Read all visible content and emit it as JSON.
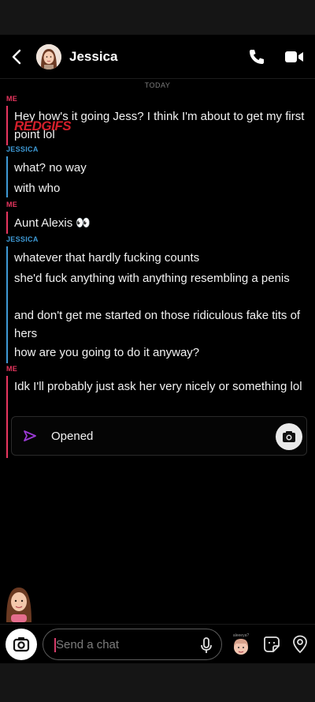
{
  "header": {
    "contact_name": "Jessica"
  },
  "chat": {
    "date_divider": "TODAY",
    "watermark": "REDGIFS",
    "sender_me": "ME",
    "sender_jessica": "JESSICA",
    "messages": [
      "Hey how's it going Jess? I think I'm about to get my first point lol",
      "what? no way",
      "with who",
      "Aunt Alexis 👀",
      "whatever that hardly fucking counts",
      "she'd fuck anything with anything resembling a penis",
      "and don't get me started on those ridiculous fake tits of hers",
      "how are you going to do it anyway?",
      "Idk I'll probably just ask her very nicely or something lol"
    ],
    "snap": {
      "status": "Opened"
    }
  },
  "composer": {
    "placeholder": "Send a chat",
    "bitmoji_caption": "aleeeya?"
  },
  "colors": {
    "me": "#e8365f",
    "jessica": "#3e9ad6",
    "snap_opened": "#9b3ad6"
  }
}
